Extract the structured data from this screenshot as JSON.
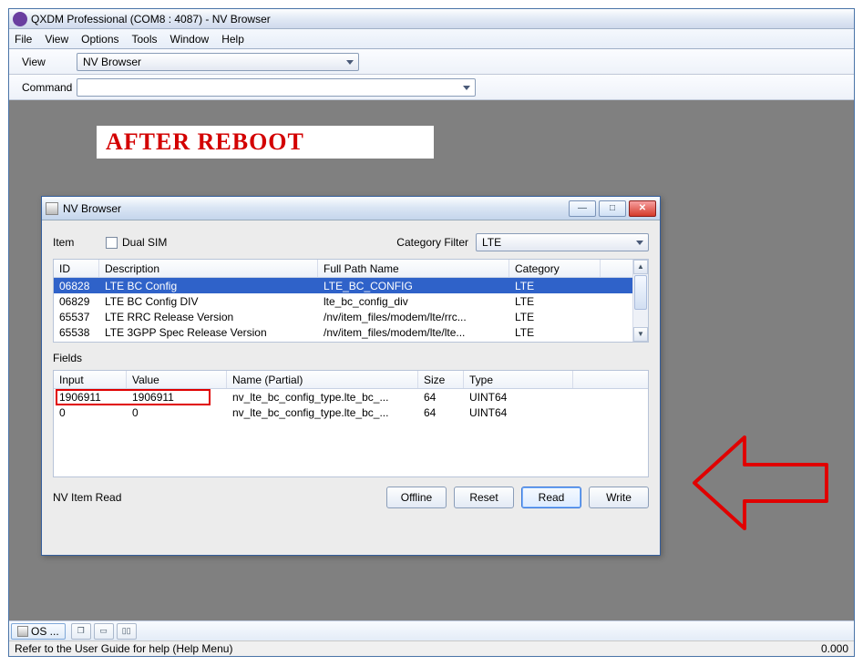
{
  "app": {
    "title": "QXDM Professional (COM8 : 4087) - NV Browser"
  },
  "menu": [
    "File",
    "View",
    "Options",
    "Tools",
    "Window",
    "Help"
  ],
  "toolbar": {
    "view_label": "View",
    "view_value": "NV Browser",
    "command_label": "Command",
    "command_value": ""
  },
  "banner": "AFTER REBOOT",
  "nvwin": {
    "title": "NV Browser",
    "item_label": "Item",
    "dualsim_label": "Dual SIM",
    "catfilter_label": "Category Filter",
    "catfilter_value": "LTE",
    "cols": {
      "id": "ID",
      "desc": "Description",
      "path": "Full Path Name",
      "cat": "Category"
    },
    "rows": [
      {
        "id": "06828",
        "desc": "LTE BC Config",
        "path": "LTE_BC_CONFIG",
        "cat": "LTE",
        "sel": true
      },
      {
        "id": "06829",
        "desc": "LTE BC Config DIV",
        "path": "lte_bc_config_div",
        "cat": "LTE",
        "sel": false
      },
      {
        "id": "65537",
        "desc": "LTE RRC Release Version",
        "path": "/nv/item_files/modem/lte/rrc...",
        "cat": "LTE",
        "sel": false
      },
      {
        "id": "65538",
        "desc": "LTE 3GPP Spec Release Version",
        "path": "/nv/item_files/modem/lte/lte...",
        "cat": "LTE",
        "sel": false
      }
    ],
    "fields_label": "Fields",
    "fcols": {
      "input": "Input",
      "value": "Value",
      "name": "Name (Partial)",
      "size": "Size",
      "type": "Type"
    },
    "frows": [
      {
        "input": "1906911",
        "value": "1906911",
        "name": "nv_lte_bc_config_type.lte_bc_...",
        "size": "64",
        "type": "UINT64"
      },
      {
        "input": "0",
        "value": "0",
        "name": "nv_lte_bc_config_type.lte_bc_...",
        "size": "64",
        "type": "UINT64"
      }
    ],
    "status": "NV Item Read",
    "buttons": {
      "offline": "Offline",
      "reset": "Reset",
      "read": "Read",
      "write": "Write"
    }
  },
  "taskbar": {
    "item": "OS ..."
  },
  "statusbar": {
    "left": "Refer to the User Guide for help (Help Menu)",
    "right": "0.000"
  }
}
